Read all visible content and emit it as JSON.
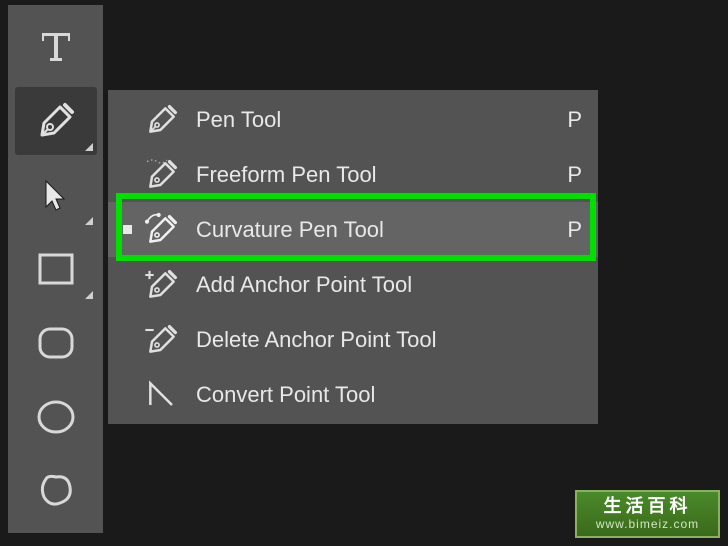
{
  "toolbar": {
    "tools": [
      {
        "name": "type-tool",
        "icon": "type"
      },
      {
        "name": "pen-tool",
        "icon": "pen",
        "active": true
      },
      {
        "name": "path-selection-tool",
        "icon": "pointer"
      },
      {
        "name": "rectangle-tool",
        "icon": "rectangle"
      },
      {
        "name": "rounded-rectangle-tool",
        "icon": "rounded-rect"
      },
      {
        "name": "ellipse-tool",
        "icon": "ellipse"
      },
      {
        "name": "custom-shape-tool",
        "icon": "blob"
      }
    ]
  },
  "flyout": {
    "items": [
      {
        "label": "Pen Tool",
        "shortcut": "P",
        "icon": "pen",
        "selected": false
      },
      {
        "label": "Freeform Pen Tool",
        "shortcut": "P",
        "icon": "freeform-pen",
        "selected": false
      },
      {
        "label": "Curvature Pen Tool",
        "shortcut": "P",
        "icon": "curvature-pen",
        "selected": true
      },
      {
        "label": "Add Anchor Point Tool",
        "shortcut": "",
        "icon": "add-anchor",
        "selected": false
      },
      {
        "label": "Delete Anchor Point Tool",
        "shortcut": "",
        "icon": "delete-anchor",
        "selected": false
      },
      {
        "label": "Convert Point Tool",
        "shortcut": "",
        "icon": "convert-point",
        "selected": false
      }
    ]
  },
  "watermark": {
    "title": "生活百科",
    "url": "www.bimeiz.com"
  }
}
